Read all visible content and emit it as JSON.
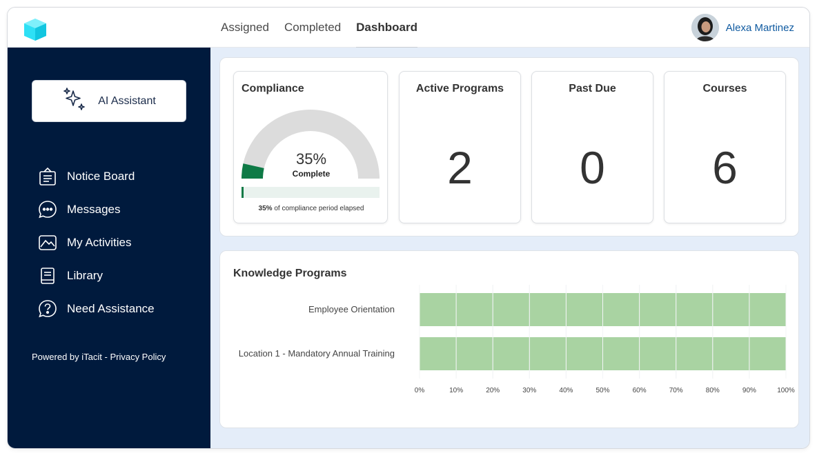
{
  "header": {
    "logo_icon": "cube-logo-icon",
    "tabs": [
      {
        "label": "Assigned",
        "active": false
      },
      {
        "label": "Completed",
        "active": false
      },
      {
        "label": "Dashboard",
        "active": true
      }
    ],
    "user": {
      "name": "Alexa Martinez",
      "avatar_icon": "user-avatar"
    }
  },
  "sidebar": {
    "ai_assistant": {
      "label": "AI Assistant",
      "icon": "sparkles-icon"
    },
    "items": [
      {
        "label": "Notice Board",
        "icon": "notice-board-icon"
      },
      {
        "label": "Messages",
        "icon": "chat-bubble-icon"
      },
      {
        "label": "My Activities",
        "icon": "activity-icon"
      },
      {
        "label": "Library",
        "icon": "book-icon"
      },
      {
        "label": "Need Assistance",
        "icon": "help-icon"
      }
    ],
    "footer": {
      "powered": "Powered by iTacit",
      "separator": " - ",
      "privacy": "Privacy Policy"
    }
  },
  "cards": {
    "compliance": {
      "title": "Compliance",
      "percent": 35,
      "percent_text": "35%",
      "status": "Complete",
      "elapsed_percent": 35,
      "elapsed_value": "35%",
      "elapsed_text": "of compliance period elapsed"
    },
    "active_programs": {
      "title": "Active Programs",
      "value": "2"
    },
    "past_due": {
      "title": "Past Due",
      "value": "0"
    },
    "courses": {
      "title": "Courses",
      "value": "6"
    }
  },
  "knowledge_programs": {
    "title": "Knowledge Programs"
  },
  "colors": {
    "sidebar_bg": "#001a3d",
    "accent_blue": "#0f5aa0",
    "gauge_fill": "#0e7a46",
    "gauge_track": "#dcdcdc",
    "bar_fill": "#a9d3a2",
    "main_bg": "#e4edf9"
  },
  "chart_data": {
    "type": "bar",
    "orientation": "horizontal",
    "categories": [
      "Employee Orientation",
      "Location 1 - Mandatory Annual Training"
    ],
    "values": [
      100,
      100
    ],
    "xlim": [
      0,
      100
    ],
    "x_ticks": [
      "0%",
      "10%",
      "20%",
      "30%",
      "40%",
      "50%",
      "60%",
      "70%",
      "80%",
      "90%",
      "100%"
    ],
    "grid": true
  }
}
